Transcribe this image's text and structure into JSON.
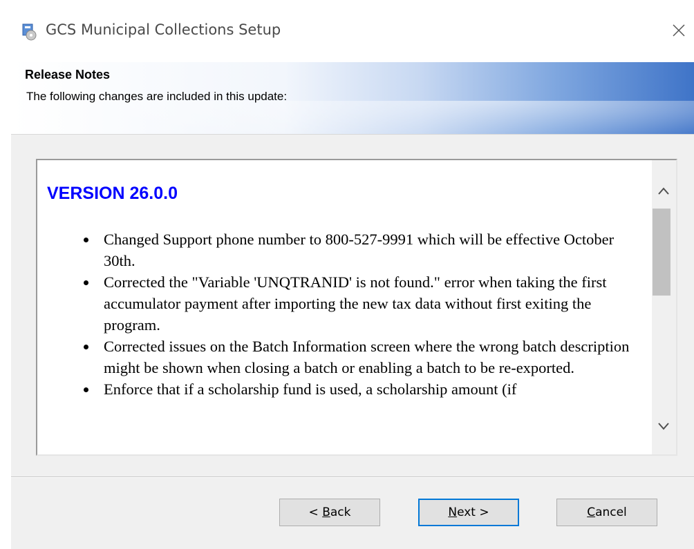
{
  "window": {
    "title": "GCS Municipal Collections Setup",
    "icon": "setup-installer-icon",
    "close_icon": "close-icon"
  },
  "banner": {
    "title": "Release Notes",
    "subtitle": "The following changes are included in this update:"
  },
  "notes": {
    "version_heading": "VERSION 26.0.0",
    "items": [
      "Changed Support phone number to 800-527-9991 which will be effective October 30th.",
      "Corrected the \"Variable 'UNQTRANID' is not found.\" error when taking the first accumulator payment after importing the new tax data without first exiting the program.",
      "Corrected issues on the Batch Information screen where the wrong batch description might be shown when closing a batch or enabling a batch to be re-exported.",
      "Enforce that if a scholarship fund is used, a scholarship amount (if "
    ]
  },
  "buttons": {
    "back": {
      "prefix": "< ",
      "mnemonic": "B",
      "rest": "ack"
    },
    "next": {
      "prefix": "",
      "mnemonic": "N",
      "rest": "ext >"
    },
    "cancel": {
      "prefix": "",
      "mnemonic": "C",
      "rest": "ancel"
    }
  },
  "colors": {
    "version_heading": "#0000ff",
    "default_button_border": "#0078d7"
  }
}
